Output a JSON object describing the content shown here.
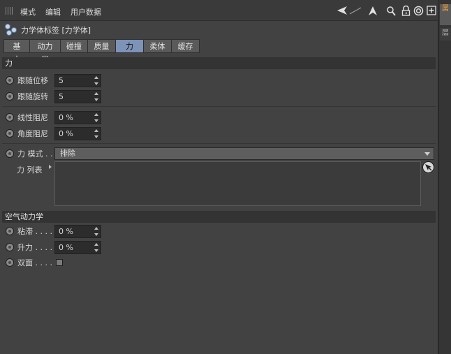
{
  "menubar": {
    "items": [
      "模式",
      "编辑",
      "用户数据"
    ]
  },
  "toolbar_icons": [
    "back-arrow-icon",
    "up-arrow-icon",
    "search-icon",
    "lock-icon",
    "target-icon",
    "add-icon"
  ],
  "side_tabs": [
    "属",
    "层"
  ],
  "header": {
    "title": "力学体标签 [力学体]"
  },
  "tabs": [
    {
      "label": "基本",
      "active": false
    },
    {
      "label": "动力学",
      "active": false
    },
    {
      "label": "碰撞",
      "active": false
    },
    {
      "label": "质量",
      "active": false
    },
    {
      "label": "力",
      "active": true
    },
    {
      "label": "柔体",
      "active": false
    },
    {
      "label": "缓存",
      "active": false
    }
  ],
  "force_section": {
    "title": "力",
    "follow_position": {
      "label": "跟随位移",
      "value": "5"
    },
    "follow_rotation": {
      "label": "跟随旋转",
      "value": "5"
    },
    "linear_damping": {
      "label": "线性阻尼",
      "value": "0 %"
    },
    "angular_damping": {
      "label": "角度阻尼",
      "value": "0 %"
    },
    "force_mode": {
      "label": "力 模式 . .",
      "value": "排除"
    },
    "force_list": {
      "label": "力 列表"
    }
  },
  "aero_section": {
    "title": "空气动力学",
    "viscosity": {
      "label": "粘滞 . . . .",
      "value": "0 %"
    },
    "lift": {
      "label": "升力 . . . .",
      "value": "0 %"
    },
    "two_sided": {
      "label": "双面 . . . ."
    }
  },
  "colors": {
    "active_tab": "#7d93b8",
    "panel_bg": "#424242"
  }
}
